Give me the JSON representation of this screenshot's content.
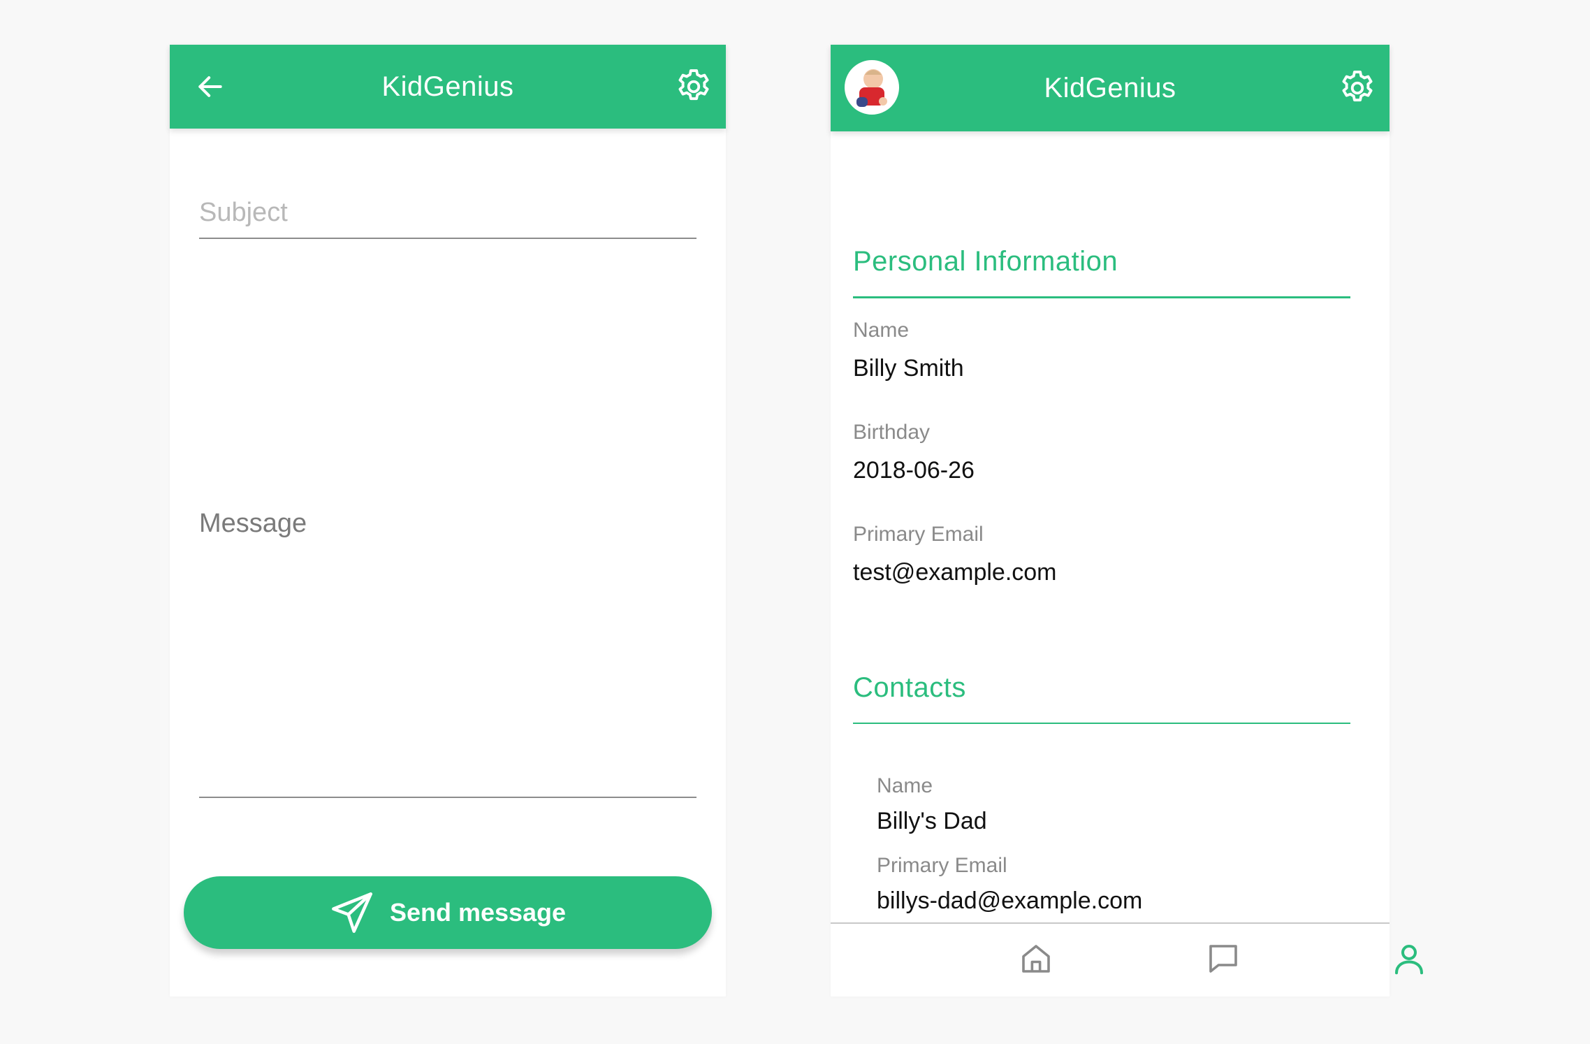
{
  "app_name": "KidGenius",
  "colors": {
    "accent": "#2bbd7e",
    "label_gray": "#8a8a8a",
    "text_dark": "#111111"
  },
  "compose_screen": {
    "header": {
      "title": "KidGenius",
      "back_icon": "arrow-left-icon",
      "settings_icon": "gear-icon"
    },
    "subject": {
      "placeholder": "Subject",
      "value": ""
    },
    "message": {
      "label": "Message",
      "value": ""
    },
    "send_button": {
      "label": "Send message",
      "icon": "paper-plane-icon"
    }
  },
  "profile_screen": {
    "header": {
      "title": "KidGenius",
      "avatar": "child-avatar",
      "settings_icon": "gear-icon"
    },
    "personal_info": {
      "title": "Personal Information",
      "fields": [
        {
          "label": "Name",
          "value": "Billy Smith"
        },
        {
          "label": "Birthday",
          "value": "2018-06-26"
        },
        {
          "label": "Primary Email",
          "value": "test@example.com"
        }
      ]
    },
    "contacts": {
      "title": "Contacts",
      "items": [
        {
          "name_label": "Name",
          "name": "Billy's Dad",
          "email_label": "Primary Email",
          "email": "billys-dad@example.com"
        }
      ]
    },
    "bottom_nav": [
      {
        "icon": "home-icon",
        "active": false
      },
      {
        "icon": "chat-icon",
        "active": false
      },
      {
        "icon": "person-icon",
        "active": true
      }
    ]
  }
}
